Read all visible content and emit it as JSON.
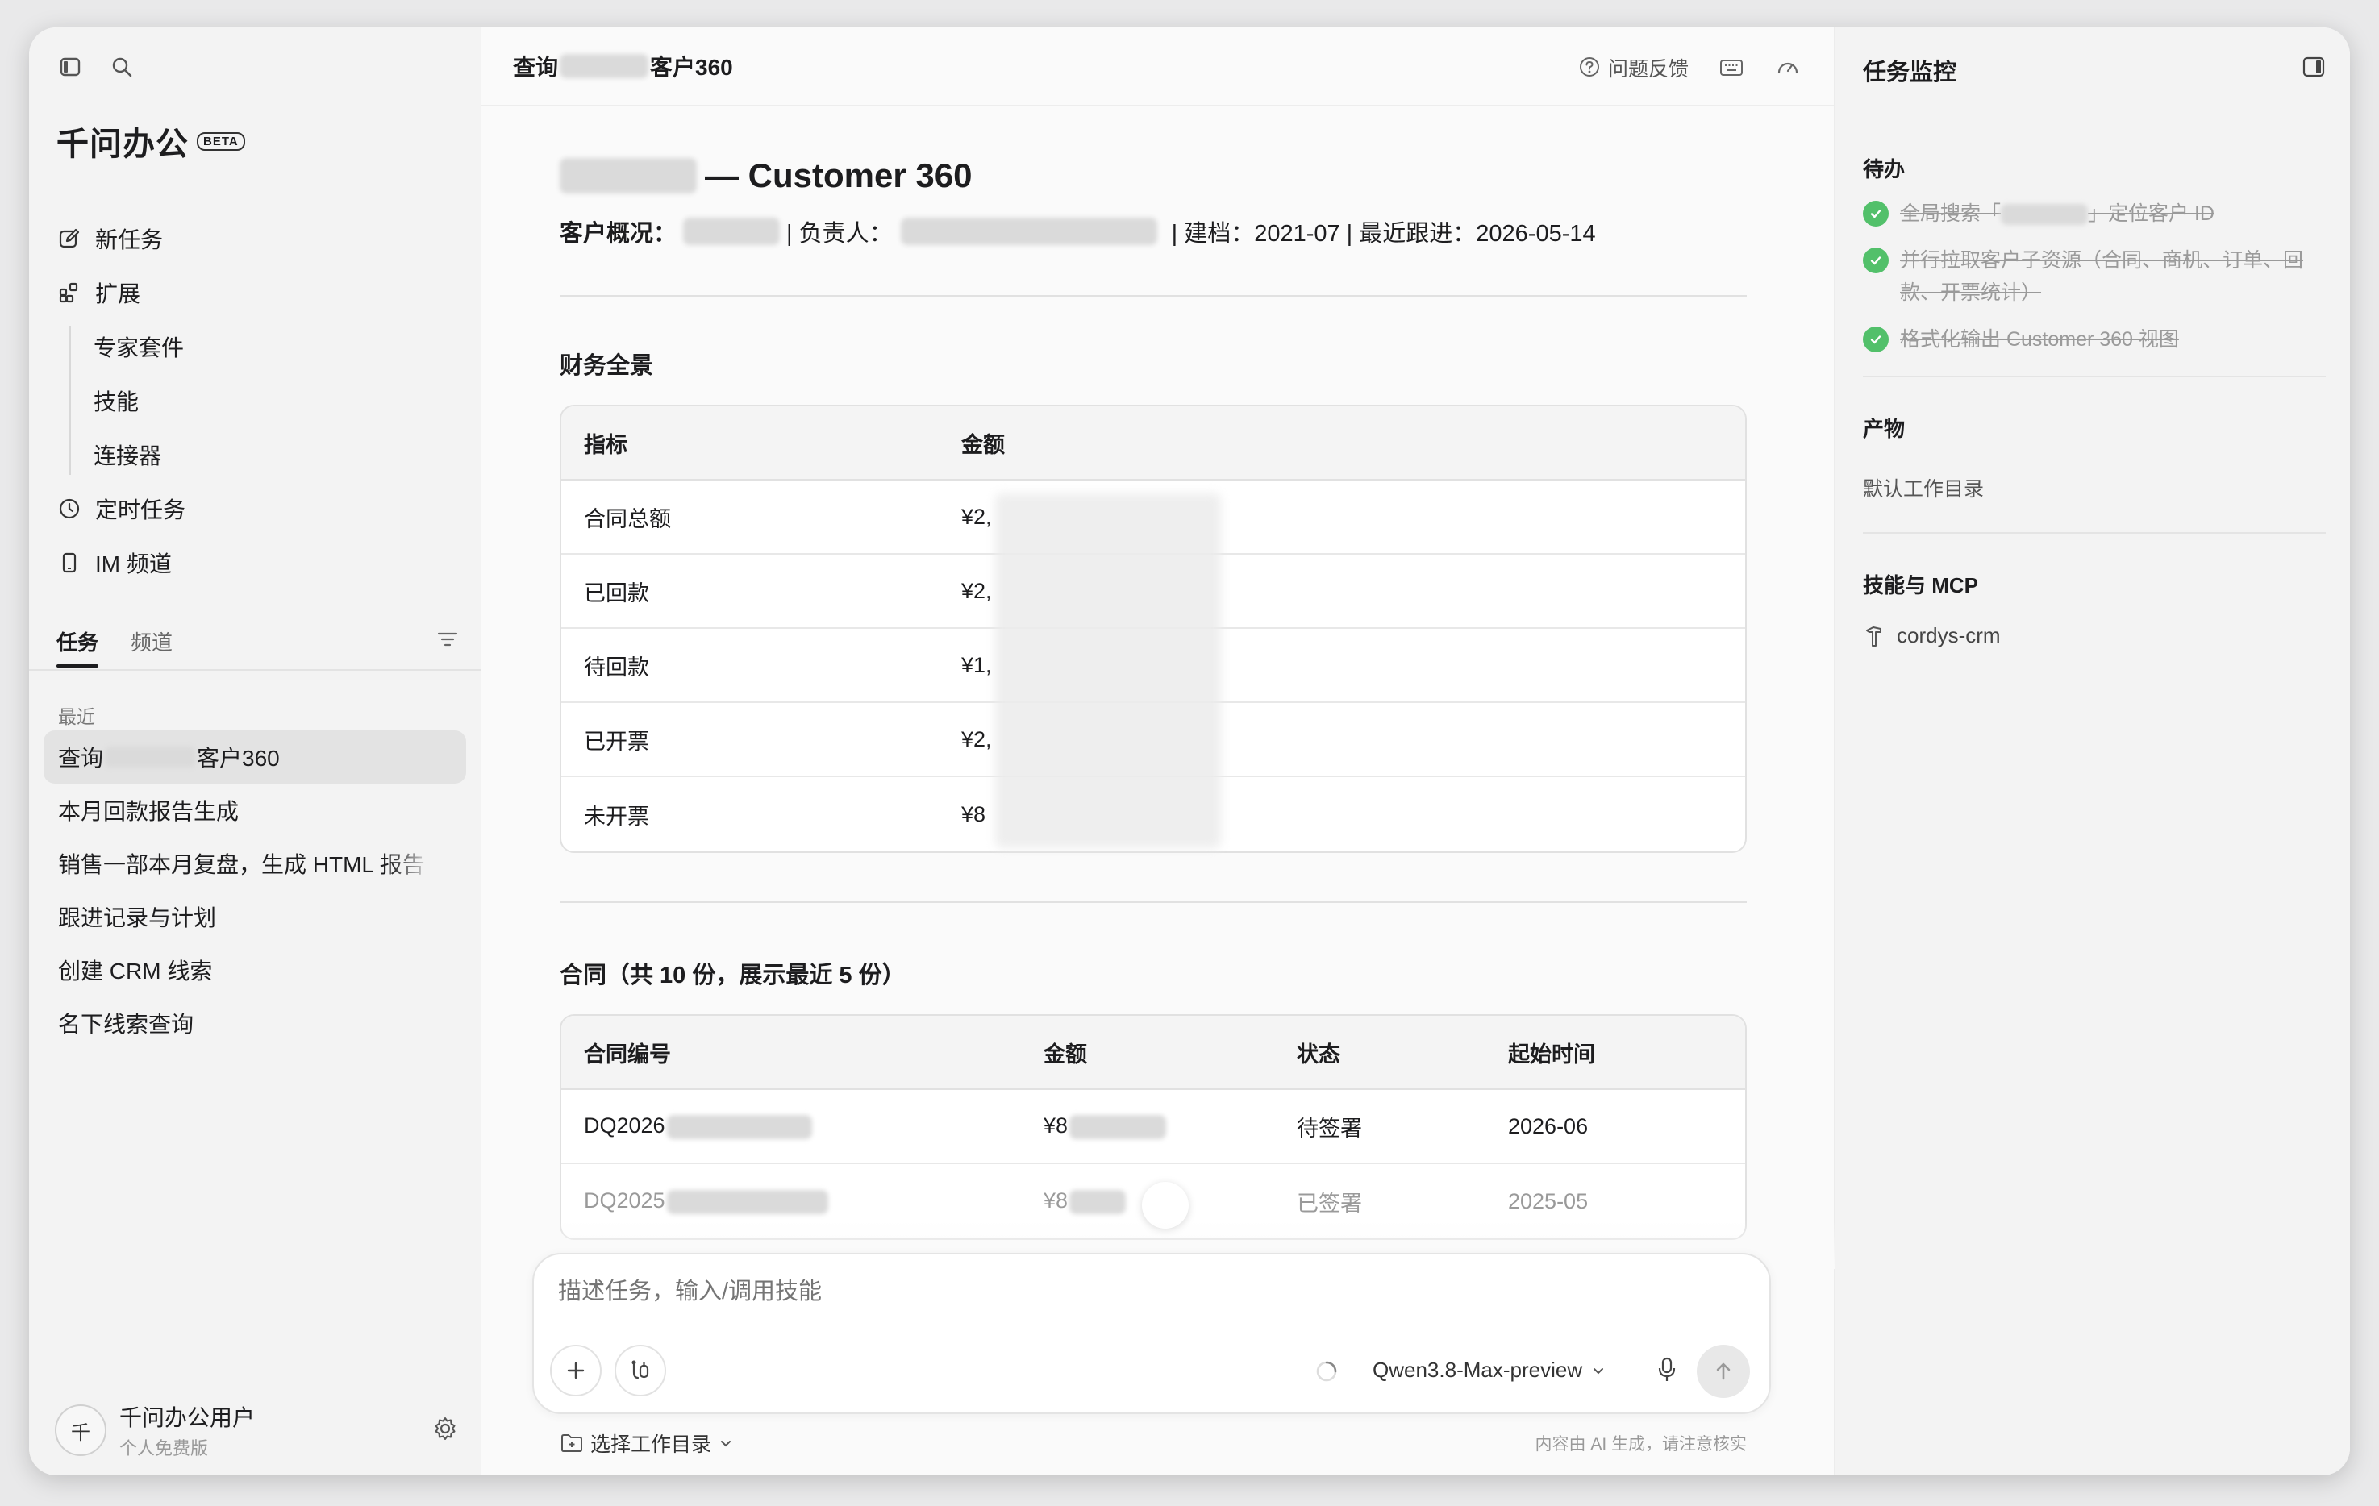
{
  "sidebar": {
    "brand": "千问办公",
    "beta": "BETA",
    "nav": {
      "new_task": "新任务",
      "extensions": "扩展",
      "expert_suite": "专家套件",
      "skills": "技能",
      "connectors": "连接器",
      "scheduled": "定时任务",
      "im_channel": "IM 频道"
    },
    "tabs": {
      "tasks": "任务",
      "channels": "频道"
    },
    "recent_label": "最近",
    "recent": [
      {
        "prefix": "查询",
        "suffix": "客户360"
      },
      {
        "label": "本月回款报告生成"
      },
      {
        "label": "销售一部本月复盘，生成 HTML 报告"
      },
      {
        "label": "跟进记录与计划"
      },
      {
        "label": "创建 CRM 线索"
      },
      {
        "label": "名下线索查询"
      }
    ],
    "user": {
      "avatar": "千",
      "name": "千问办公用户",
      "plan": "个人免费版"
    }
  },
  "header": {
    "title_prefix": "查询",
    "title_suffix": "客户360",
    "feedback": "问题反馈"
  },
  "doc": {
    "title_suffix": "— Customer 360",
    "meta": {
      "overview_label": "客户概况：",
      "owner_label": "| 负责人：",
      "rest": "| 建档：2021-07 | 最近跟进：2026-05-14"
    },
    "finance": {
      "heading": "财务全景",
      "columns": [
        "指标",
        "金额"
      ],
      "rows": [
        {
          "metric": "合同总额",
          "amount": "¥2,"
        },
        {
          "metric": "已回款",
          "amount": "¥2,"
        },
        {
          "metric": "待回款",
          "amount": "¥1,"
        },
        {
          "metric": "已开票",
          "amount": "¥2,"
        },
        {
          "metric": "未开票",
          "amount": "¥8"
        }
      ]
    },
    "contracts": {
      "heading": "合同（共 10 份，展示最近 5 份）",
      "columns": [
        "合同编号",
        "金额",
        "状态",
        "起始时间"
      ],
      "rows": [
        {
          "id": "DQ2026",
          "amount": "¥8",
          "status": "待签署",
          "start": "2026-06"
        },
        {
          "id": "DQ2025",
          "amount": "¥8",
          "status": "已签署",
          "start": "2025-05"
        }
      ]
    }
  },
  "composer": {
    "placeholder": "描述任务，输入/调用技能",
    "model": "Qwen3.8-Max-preview",
    "workdir": "选择工作目录",
    "disclaimer": "内容由 AI 生成，请注意核实"
  },
  "right_panel": {
    "title": "任务监控",
    "todo_heading": "待办",
    "todos": [
      {
        "prefix": "全局搜索「",
        "suffix": "」定位客户 ID"
      },
      {
        "label": "并行拉取客户子资源（合同、商机、订单、回款、开票统计）"
      },
      {
        "label": "格式化输出 Customer 360 视图"
      }
    ],
    "artifacts_heading": "产物",
    "artifact": "默认工作目录",
    "skills_heading": "技能与 MCP",
    "skill": "cordys-crm"
  },
  "colors": {
    "check": "#52c06a",
    "sidebar_bg": "#f3f3f3"
  }
}
